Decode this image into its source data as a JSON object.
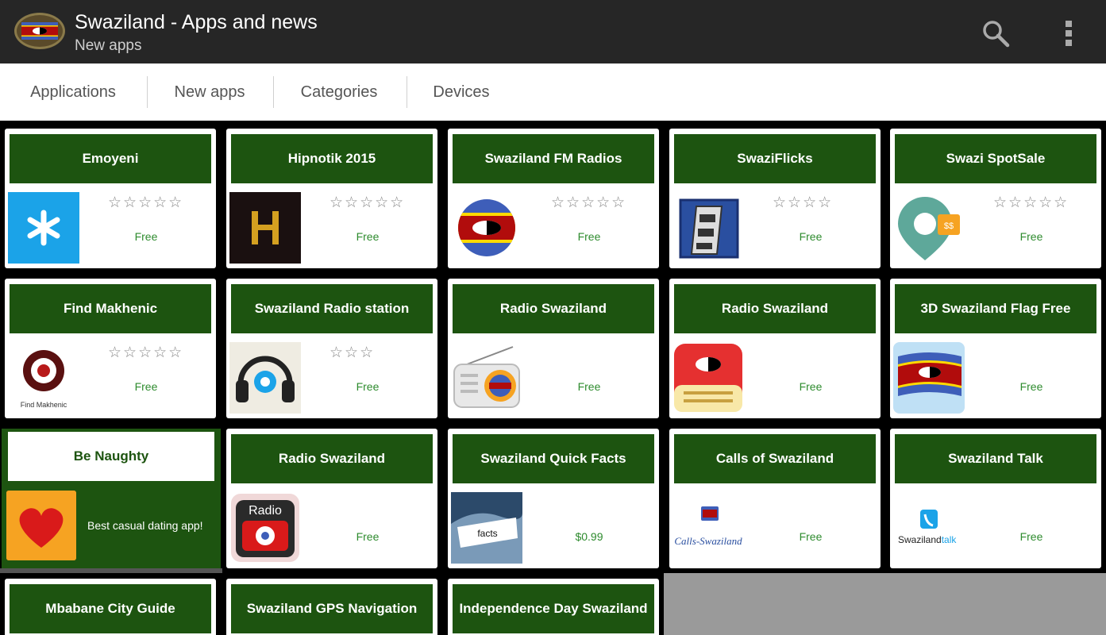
{
  "header": {
    "title": "Swaziland - Apps and news",
    "subtitle": "New apps"
  },
  "tabs": [
    "Applications",
    "New apps",
    "Categories",
    "Devices"
  ],
  "cards": [
    {
      "title": "Emoyeni",
      "stars": "☆☆☆☆☆",
      "price": "Free",
      "icon": "star-icon"
    },
    {
      "title": "Hipnotik 2015",
      "stars": "☆☆☆☆☆",
      "price": "Free",
      "icon": "letter-h-icon"
    },
    {
      "title": "Swaziland FM Radios",
      "stars": "☆☆☆☆☆",
      "price": "Free",
      "icon": "flag-globe-icon"
    },
    {
      "title": "SwaziFlicks",
      "stars": "☆☆☆☆",
      "price": "Free",
      "icon": "film-reel-icon"
    },
    {
      "title": "Swazi SpotSale",
      "stars": "☆☆☆☆☆",
      "price": "Free",
      "icon": "map-pin-icon"
    },
    {
      "title": "Find Makhenic",
      "stars": "☆☆☆☆☆",
      "price": "Free",
      "icon": "gear-icon"
    },
    {
      "title": "Swaziland Radio station",
      "stars": "☆☆☆",
      "price": "Free",
      "icon": "headphones-icon"
    },
    {
      "title": "Radio Swaziland",
      "stars": "",
      "price": "Free",
      "icon": "radio-icon"
    },
    {
      "title": "Radio Swaziland",
      "stars": "",
      "price": "Free",
      "icon": "radio-icon"
    },
    {
      "title": "3D Swaziland Flag Free",
      "stars": "",
      "price": "Free",
      "icon": "flag-icon"
    },
    {
      "title": "Radio Swaziland",
      "stars": "",
      "price": "Free",
      "icon": "radio-icon"
    },
    {
      "title": "Swaziland Quick Facts",
      "stars": "",
      "price": "$0.99",
      "icon": "globe-icon"
    },
    {
      "title": "Calls of Swaziland",
      "stars": "",
      "price": "Free",
      "icon": "phone-icon"
    },
    {
      "title": "Swaziland Talk",
      "stars": "",
      "price": "Free",
      "icon": "phone-icon"
    },
    {
      "title": "Mbabane City Guide",
      "stars": "",
      "price": "",
      "icon": ""
    },
    {
      "title": "Swaziland GPS Navigation",
      "stars": "",
      "price": "",
      "icon": ""
    },
    {
      "title": "Independence Day Swaziland",
      "stars": "",
      "price": "",
      "icon": ""
    }
  ],
  "promo": {
    "title": "Be Naughty",
    "text": "Best casual dating app!",
    "icon": "heart-icon"
  },
  "icon_labels": {
    "find_makhenic": "Find Makhenic",
    "radio": "Radio",
    "calls": "Calls-Swaziland",
    "talk_a": "Swaziland",
    "talk_b": "talk",
    "quick": "facts"
  },
  "colors": {
    "actionbar": "#262626",
    "header_green": "#1d5410",
    "price_green": "#2e8b2e"
  }
}
